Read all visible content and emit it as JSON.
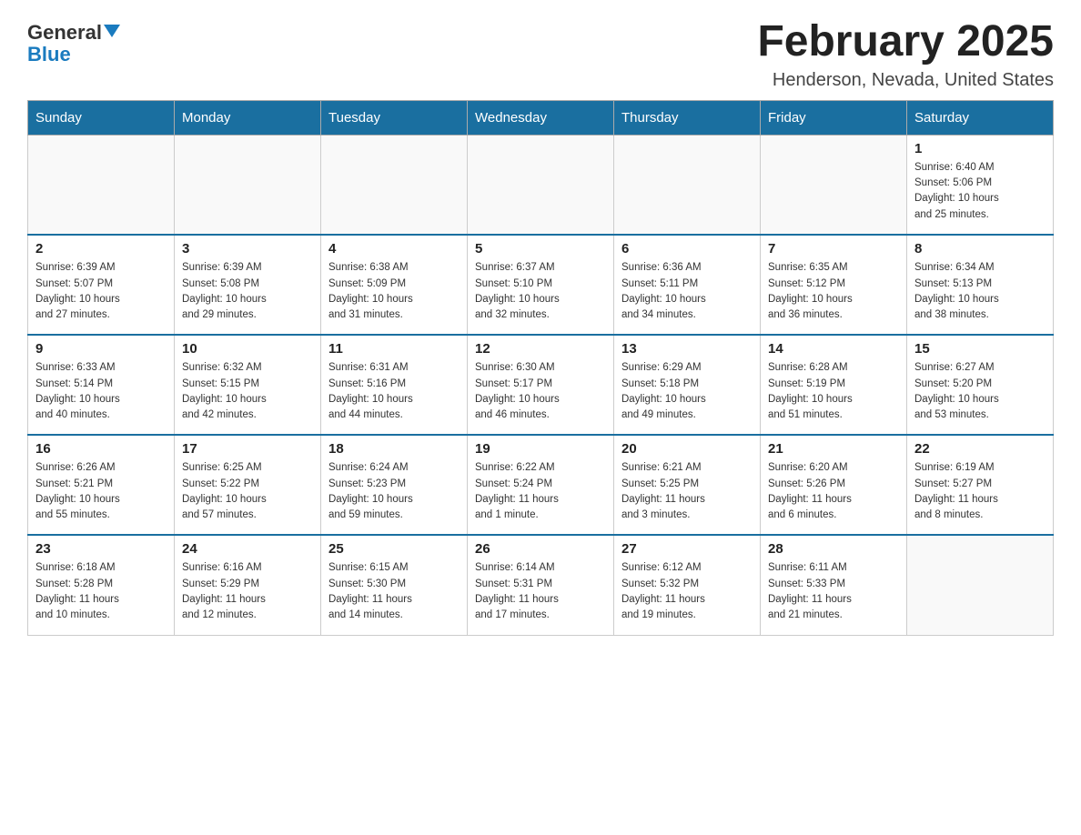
{
  "header": {
    "logo_general": "General",
    "logo_blue": "Blue",
    "month_title": "February 2025",
    "location": "Henderson, Nevada, United States"
  },
  "weekdays": [
    "Sunday",
    "Monday",
    "Tuesday",
    "Wednesday",
    "Thursday",
    "Friday",
    "Saturday"
  ],
  "weeks": [
    [
      {
        "day": "",
        "info": ""
      },
      {
        "day": "",
        "info": ""
      },
      {
        "day": "",
        "info": ""
      },
      {
        "day": "",
        "info": ""
      },
      {
        "day": "",
        "info": ""
      },
      {
        "day": "",
        "info": ""
      },
      {
        "day": "1",
        "info": "Sunrise: 6:40 AM\nSunset: 5:06 PM\nDaylight: 10 hours\nand 25 minutes."
      }
    ],
    [
      {
        "day": "2",
        "info": "Sunrise: 6:39 AM\nSunset: 5:07 PM\nDaylight: 10 hours\nand 27 minutes."
      },
      {
        "day": "3",
        "info": "Sunrise: 6:39 AM\nSunset: 5:08 PM\nDaylight: 10 hours\nand 29 minutes."
      },
      {
        "day": "4",
        "info": "Sunrise: 6:38 AM\nSunset: 5:09 PM\nDaylight: 10 hours\nand 31 minutes."
      },
      {
        "day": "5",
        "info": "Sunrise: 6:37 AM\nSunset: 5:10 PM\nDaylight: 10 hours\nand 32 minutes."
      },
      {
        "day": "6",
        "info": "Sunrise: 6:36 AM\nSunset: 5:11 PM\nDaylight: 10 hours\nand 34 minutes."
      },
      {
        "day": "7",
        "info": "Sunrise: 6:35 AM\nSunset: 5:12 PM\nDaylight: 10 hours\nand 36 minutes."
      },
      {
        "day": "8",
        "info": "Sunrise: 6:34 AM\nSunset: 5:13 PM\nDaylight: 10 hours\nand 38 minutes."
      }
    ],
    [
      {
        "day": "9",
        "info": "Sunrise: 6:33 AM\nSunset: 5:14 PM\nDaylight: 10 hours\nand 40 minutes."
      },
      {
        "day": "10",
        "info": "Sunrise: 6:32 AM\nSunset: 5:15 PM\nDaylight: 10 hours\nand 42 minutes."
      },
      {
        "day": "11",
        "info": "Sunrise: 6:31 AM\nSunset: 5:16 PM\nDaylight: 10 hours\nand 44 minutes."
      },
      {
        "day": "12",
        "info": "Sunrise: 6:30 AM\nSunset: 5:17 PM\nDaylight: 10 hours\nand 46 minutes."
      },
      {
        "day": "13",
        "info": "Sunrise: 6:29 AM\nSunset: 5:18 PM\nDaylight: 10 hours\nand 49 minutes."
      },
      {
        "day": "14",
        "info": "Sunrise: 6:28 AM\nSunset: 5:19 PM\nDaylight: 10 hours\nand 51 minutes."
      },
      {
        "day": "15",
        "info": "Sunrise: 6:27 AM\nSunset: 5:20 PM\nDaylight: 10 hours\nand 53 minutes."
      }
    ],
    [
      {
        "day": "16",
        "info": "Sunrise: 6:26 AM\nSunset: 5:21 PM\nDaylight: 10 hours\nand 55 minutes."
      },
      {
        "day": "17",
        "info": "Sunrise: 6:25 AM\nSunset: 5:22 PM\nDaylight: 10 hours\nand 57 minutes."
      },
      {
        "day": "18",
        "info": "Sunrise: 6:24 AM\nSunset: 5:23 PM\nDaylight: 10 hours\nand 59 minutes."
      },
      {
        "day": "19",
        "info": "Sunrise: 6:22 AM\nSunset: 5:24 PM\nDaylight: 11 hours\nand 1 minute."
      },
      {
        "day": "20",
        "info": "Sunrise: 6:21 AM\nSunset: 5:25 PM\nDaylight: 11 hours\nand 3 minutes."
      },
      {
        "day": "21",
        "info": "Sunrise: 6:20 AM\nSunset: 5:26 PM\nDaylight: 11 hours\nand 6 minutes."
      },
      {
        "day": "22",
        "info": "Sunrise: 6:19 AM\nSunset: 5:27 PM\nDaylight: 11 hours\nand 8 minutes."
      }
    ],
    [
      {
        "day": "23",
        "info": "Sunrise: 6:18 AM\nSunset: 5:28 PM\nDaylight: 11 hours\nand 10 minutes."
      },
      {
        "day": "24",
        "info": "Sunrise: 6:16 AM\nSunset: 5:29 PM\nDaylight: 11 hours\nand 12 minutes."
      },
      {
        "day": "25",
        "info": "Sunrise: 6:15 AM\nSunset: 5:30 PM\nDaylight: 11 hours\nand 14 minutes."
      },
      {
        "day": "26",
        "info": "Sunrise: 6:14 AM\nSunset: 5:31 PM\nDaylight: 11 hours\nand 17 minutes."
      },
      {
        "day": "27",
        "info": "Sunrise: 6:12 AM\nSunset: 5:32 PM\nDaylight: 11 hours\nand 19 minutes."
      },
      {
        "day": "28",
        "info": "Sunrise: 6:11 AM\nSunset: 5:33 PM\nDaylight: 11 hours\nand 21 minutes."
      },
      {
        "day": "",
        "info": ""
      }
    ]
  ]
}
